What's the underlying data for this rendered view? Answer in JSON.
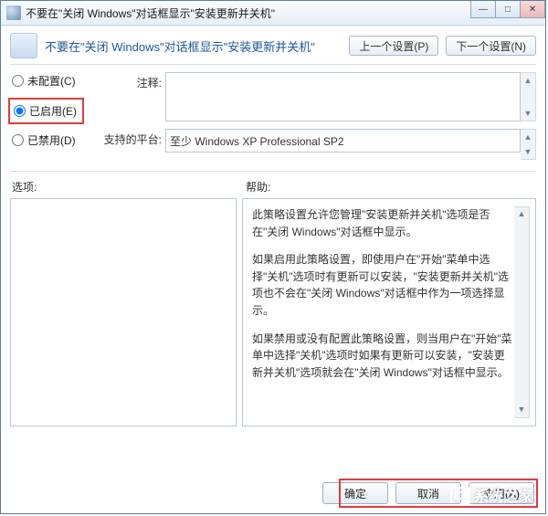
{
  "window": {
    "title": "不要在\"关闭 Windows\"对话框显示\"安装更新并关机\""
  },
  "winControls": {
    "min": "—",
    "max": "□",
    "close": "✕"
  },
  "header": {
    "title": "不要在\"关闭 Windows\"对话框显示\"安装更新并关机\""
  },
  "nav": {
    "prev": "上一个设置(P)",
    "next": "下一个设置(N)"
  },
  "radios": {
    "notConfigured": "未配置(C)",
    "enabled": "已启用(E)",
    "disabled": "已禁用(D)"
  },
  "fields": {
    "commentLabel": "注释:",
    "commentValue": "",
    "platformLabel": "支持的平台:",
    "platformValue": "至少 Windows XP Professional SP2"
  },
  "sections": {
    "options": "选项:",
    "help": "帮助:"
  },
  "help": {
    "p1": "此策略设置允许您管理\"安装更新并关机\"选项是否在\"关闭 Windows\"对话框中显示。",
    "p2": "如果启用此策略设置，即使用户在\"开始\"菜单中选择\"关机\"选项时有更新可以安装，\"安装更新并关机\"选项也不会在\"关闭 Windows\"对话框中作为一项选择显示。",
    "p3": "如果禁用或没有配置此策略设置，则当用户在\"开始\"菜单中选择\"关机\"选项时如果有更新可以安装，\"安装更新并关机\"选项就会在\"关闭 Windows\"对话框中显示。"
  },
  "footer": {
    "ok": "确定",
    "cancel": "取消",
    "apply": "应用(A)"
  },
  "watermark": "系统之家"
}
